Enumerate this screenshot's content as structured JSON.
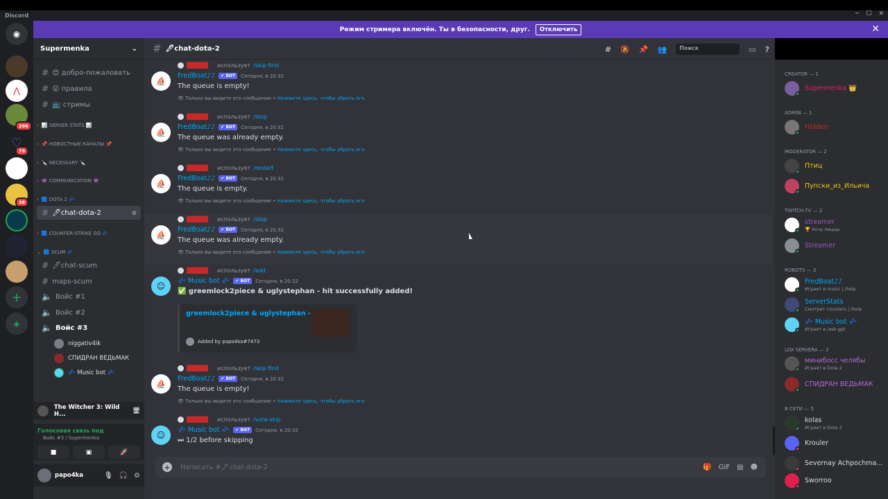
{
  "window": {
    "title": "Discord"
  },
  "banner": {
    "text": "Режим стримера включён. Ты в безопасности, друг.",
    "button": "Отключить"
  },
  "guilds": {
    "badges": [
      "296",
      "79",
      "38"
    ]
  },
  "server": {
    "name": "Supermenka"
  },
  "channels": [
    {
      "label": "😍 добро-пожаловать"
    },
    {
      "label": "😮 правила"
    },
    {
      "label": "📺 стримы"
    }
  ],
  "categories": [
    "📊 SERVER STATS 📊",
    "📌 НОВОСТНЫЕ КАНАЛЫ 📌",
    "🔪 NECESSARY 🔪",
    "👾 COMMUNICATION 👾",
    "🟦 DOTA 2 💤",
    "🟦 COUNTER-STRIKE GO 💤",
    "🟦 SCUM 💤"
  ],
  "dota_channel": "🖊chat-dota-2",
  "scum_channels": [
    "🖊chat-scum",
    "maps-scum",
    "Войс #1",
    "Войс #2",
    "Войс #3"
  ],
  "voice_users": [
    "niggativ4ik",
    "СПИДРАН ВЕДЬМАК",
    "💤 Music bot 💤"
  ],
  "game": "The Witcher 3: Wild H...",
  "voice_status": {
    "title": "Голосовая связь под",
    "sub": "Войс #3 / Supermenka"
  },
  "user": {
    "name": "papo4ka"
  },
  "chat": {
    "channel": "🖊chat-dota-2",
    "search": "Поиск",
    "input_placeholder": "Написать #🖊chat-dota-2"
  },
  "labels": {
    "uses": "использует",
    "bot": "✔ БОТ",
    "eph": "Только вы видите это сообщение •",
    "eph_link": "Нажмите здесь, чтобы убрать его",
    "time": "Сегодня, в 20:32"
  },
  "messages": [
    {
      "cmd": "/skip first",
      "author": "FredBoat♪♪",
      "text": "The queue is empty!"
    },
    {
      "cmd": "/stop",
      "author": "FredBoat♪♪",
      "text": "The queue was already empty."
    },
    {
      "cmd": "/restart",
      "author": "FredBoat♪♪",
      "text": "The queue is empty."
    },
    {
      "cmd": "/stop",
      "author": "FredBoat♪♪",
      "text": "The queue was already empty."
    },
    {
      "cmd": "/add",
      "author": "💤 Music bot 💤",
      "text": "✅ greemlock2piece & uglystephan - hit successfully added!"
    },
    {
      "cmd": "/skip first",
      "author": "FredBoat♪♪",
      "text": "The queue is empty!"
    },
    {
      "cmd": "/vote-skip",
      "author": "💤 Music bot 💤",
      "text": "⏭ 1/2 before skipping"
    }
  ],
  "embed": {
    "title": "greemlock2piece & uglystephan - hit",
    "footer": "Added by papo4ka#7473"
  },
  "members": {
    "cats": [
      "CREATOR — 1",
      "ADMIN — 1",
      "MODERATOR — 2",
      "TWITCH.TV — 2",
      "ROBOTS — 3",
      "LOX SERVERA — 2",
      "В СЕТИ — 5"
    ],
    "list": [
      {
        "name": "Supermenka 👑",
        "color": "#e91e63",
        "act": ""
      },
      {
        "name": "Hidden",
        "color": "#c72a2a",
        "act": ""
      },
      {
        "name": "Птиц",
        "color": "#f1c40f",
        "act": ""
      },
      {
        "name": "Пупски_из_Ильича",
        "color": "#f1c40f",
        "act": ""
      },
      {
        "name": "streamer",
        "color": "#9b59b6",
        "act": "🏆 Хочу пиццы"
      },
      {
        "name": "Streamer",
        "color": "#9b59b6",
        "act": ""
      },
      {
        "name": "FredBoat♪♪",
        "color": "#00a8fc",
        "act": "Играет в music | /help"
      },
      {
        "name": "ServerStats",
        "color": "#00a8fc",
        "act": "Смотрит counters | /help"
      },
      {
        "name": "💤 Music bot 💤",
        "color": "#00a8fc",
        "act": "Играет в /ask-gpt"
      },
      {
        "name": "минибосс челябы",
        "color": "#b36ad1",
        "act": "Играет в Dota 2"
      },
      {
        "name": "СПИДРАН ВЕДЬМАК",
        "color": "#b36ad1",
        "act": ""
      },
      {
        "name": "kolas",
        "color": "#dbdee1",
        "act": "Играет в Dota 2"
      },
      {
        "name": "Krouler",
        "color": "#dbdee1",
        "act": ""
      },
      {
        "name": "Severnay Achpochma...",
        "color": "#dbdee1",
        "act": ""
      },
      {
        "name": "Sworroo",
        "color": "#dbdee1",
        "act": ""
      }
    ]
  }
}
